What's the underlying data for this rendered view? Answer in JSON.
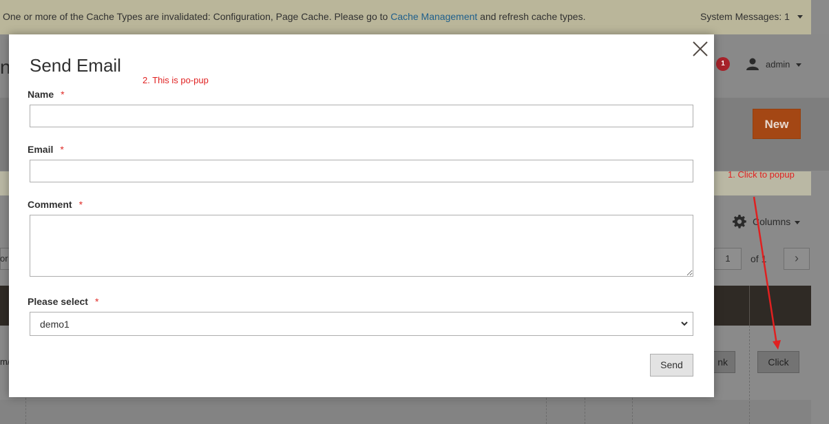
{
  "system_message": {
    "text_before": "One or more of the Cache Types are invalidated: Configuration, Page Cache. Please go to ",
    "link": "Cache Management",
    "text_after": " and refresh cache types.",
    "count_label": "System Messages: 1"
  },
  "header": {
    "partial_title": "n",
    "notification_count": "1",
    "user_label": "admin"
  },
  "actions": {
    "new_label": "New"
  },
  "toolbar": {
    "columns_label": "Columns",
    "page_value": "1",
    "page_of": "of 1",
    "left_partial": "or"
  },
  "grid": {
    "row_partial_text": "m/",
    "link_button_partial": "nk",
    "click_button": "Click"
  },
  "modal": {
    "title": "Send Email",
    "fields": {
      "name_label": "Name",
      "email_label": "Email",
      "comment_label": "Comment",
      "select_label": "Please select",
      "select_value": "demo1",
      "required_mark": "*"
    },
    "send_label": "Send"
  },
  "annotations": {
    "popup_note": "2. This is po-pup",
    "click_note": "1. Click to popup"
  },
  "colors": {
    "accent_orange": "#eb5202",
    "required_red": "#e02b27",
    "annotation_red": "#e02020",
    "link_blue": "#1979c3"
  }
}
